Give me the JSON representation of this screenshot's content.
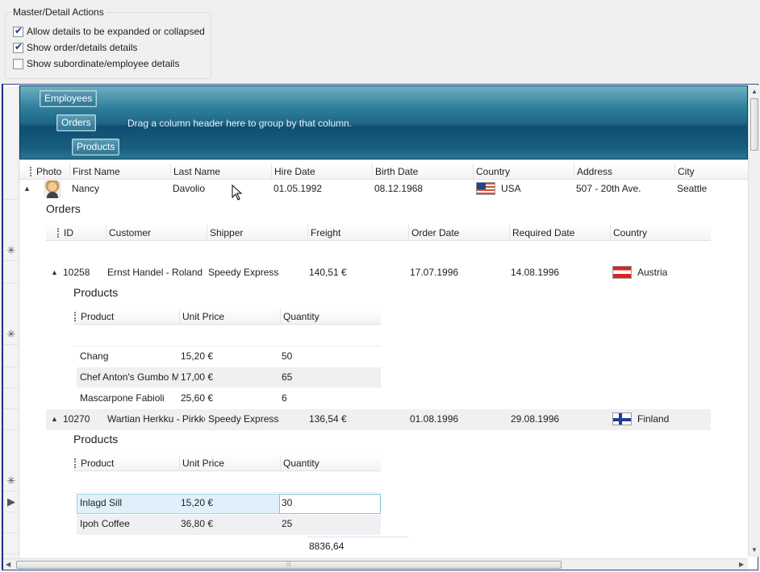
{
  "options": {
    "title": "Master/Detail Actions",
    "items": [
      {
        "label": "Allow details to be expanded or collapsed",
        "checked": true
      },
      {
        "label": "Show order/details details",
        "checked": true
      },
      {
        "label": "Show subordinate/employee details",
        "checked": false
      }
    ]
  },
  "group_panel": {
    "levels": [
      "Employees",
      "Orders",
      "Products"
    ],
    "hint": "Drag a column header here to group by that column."
  },
  "employees": {
    "columns": [
      "Photo",
      "First Name",
      "Last Name",
      "Hire Date",
      "Birth Date",
      "Country",
      "Address",
      "City"
    ],
    "row": {
      "first_name": "Nancy",
      "last_name": "Davolio",
      "hire_date": "01.05.1992",
      "birth_date": "08.12.1968",
      "country": "USA",
      "address": "507 - 20th Ave.",
      "city": "Seattle"
    }
  },
  "orders": {
    "title": "Orders",
    "columns": [
      "ID",
      "Customer",
      "Shipper",
      "Freight",
      "Order Date",
      "Required Date",
      "Country"
    ],
    "rows": [
      {
        "id": "10258",
        "customer": "Ernst Handel - Roland I",
        "shipper": "Speedy Express",
        "freight": "140,51 €",
        "order_date": "17.07.1996",
        "required_date": "14.08.1996",
        "country": "Austria",
        "products": {
          "title": "Products",
          "columns": [
            "Product",
            "Unit Price",
            "Quantity"
          ],
          "rows": [
            {
              "product": "Chang",
              "unit_price": "15,20 €",
              "quantity": "50"
            },
            {
              "product": "Chef Anton's Gumbo M",
              "unit_price": "17,00 €",
              "quantity": "65"
            },
            {
              "product": "Mascarpone Fabioli",
              "unit_price": "25,60 €",
              "quantity": "6"
            }
          ]
        }
      },
      {
        "id": "10270",
        "customer": "Wartian Herkku - Pirkko",
        "shipper": "Speedy Express",
        "freight": "136,54 €",
        "order_date": "01.08.1996",
        "required_date": "29.08.1996",
        "country": "Finland",
        "products": {
          "title": "Products",
          "columns": [
            "Product",
            "Unit Price",
            "Quantity"
          ],
          "rows": [
            {
              "product": "Inlagd Sill",
              "unit_price": "15,20 €",
              "quantity": "30"
            },
            {
              "product": "Ipoh Coffee",
              "unit_price": "36,80 €",
              "quantity": "25"
            }
          ]
        }
      }
    ],
    "freight_total": "8836,64"
  },
  "colors": {
    "group_panel": "#1e6585",
    "grid_border": "#21308c",
    "selected_row": "#dff0fa",
    "alt_row": "#f0f0f2"
  },
  "icons": {
    "expand": "caret-up-icon",
    "new_row": "asterisk-icon",
    "current_row": "triangle-right-icon"
  }
}
